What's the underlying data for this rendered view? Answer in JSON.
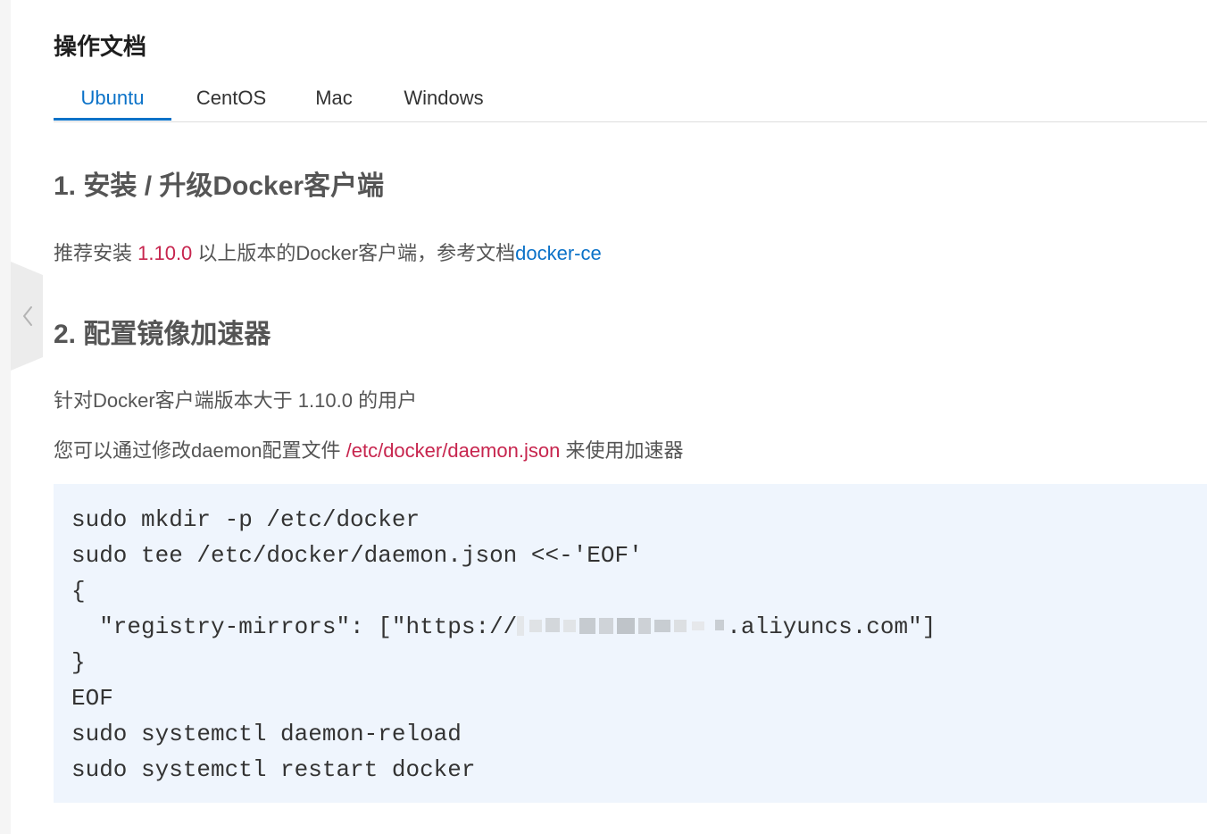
{
  "sidebar": {
    "collapse_icon": "chevron-left-icon"
  },
  "page": {
    "title": "操作文档"
  },
  "tabs": [
    {
      "label": "Ubuntu",
      "active": true
    },
    {
      "label": "CentOS",
      "active": false
    },
    {
      "label": "Mac",
      "active": false
    },
    {
      "label": "Windows",
      "active": false
    }
  ],
  "section1": {
    "heading": "1. 安装 / 升级Docker客户端",
    "text_before": "推荐安装 ",
    "version": "1.10.0",
    "text_after": " 以上版本的Docker客户端，参考文档",
    "link": "docker-ce"
  },
  "section2": {
    "heading": "2. 配置镜像加速器",
    "intro": "针对Docker客户端版本大于 1.10.0 的用户",
    "config_before": "您可以通过修改daemon配置文件 ",
    "config_path": "/etc/docker/daemon.json",
    "config_after": " 来使用加速器"
  },
  "code": {
    "lines_before": [
      "sudo mkdir -p /etc/docker",
      "sudo tee /etc/docker/daemon.json <<-'EOF'",
      "{"
    ],
    "mirror_line": {
      "prefix": "  \"registry-mirrors\": [\"https://",
      "suffix": ".aliyuncs.com\"]"
    },
    "lines_after": [
      "}",
      "EOF",
      "sudo systemctl daemon-reload",
      "sudo systemctl restart docker"
    ]
  },
  "colors": {
    "accent": "#0b72c8",
    "inline_code": "#c7254e",
    "code_background": "#eff5fd",
    "text": "#555555"
  }
}
